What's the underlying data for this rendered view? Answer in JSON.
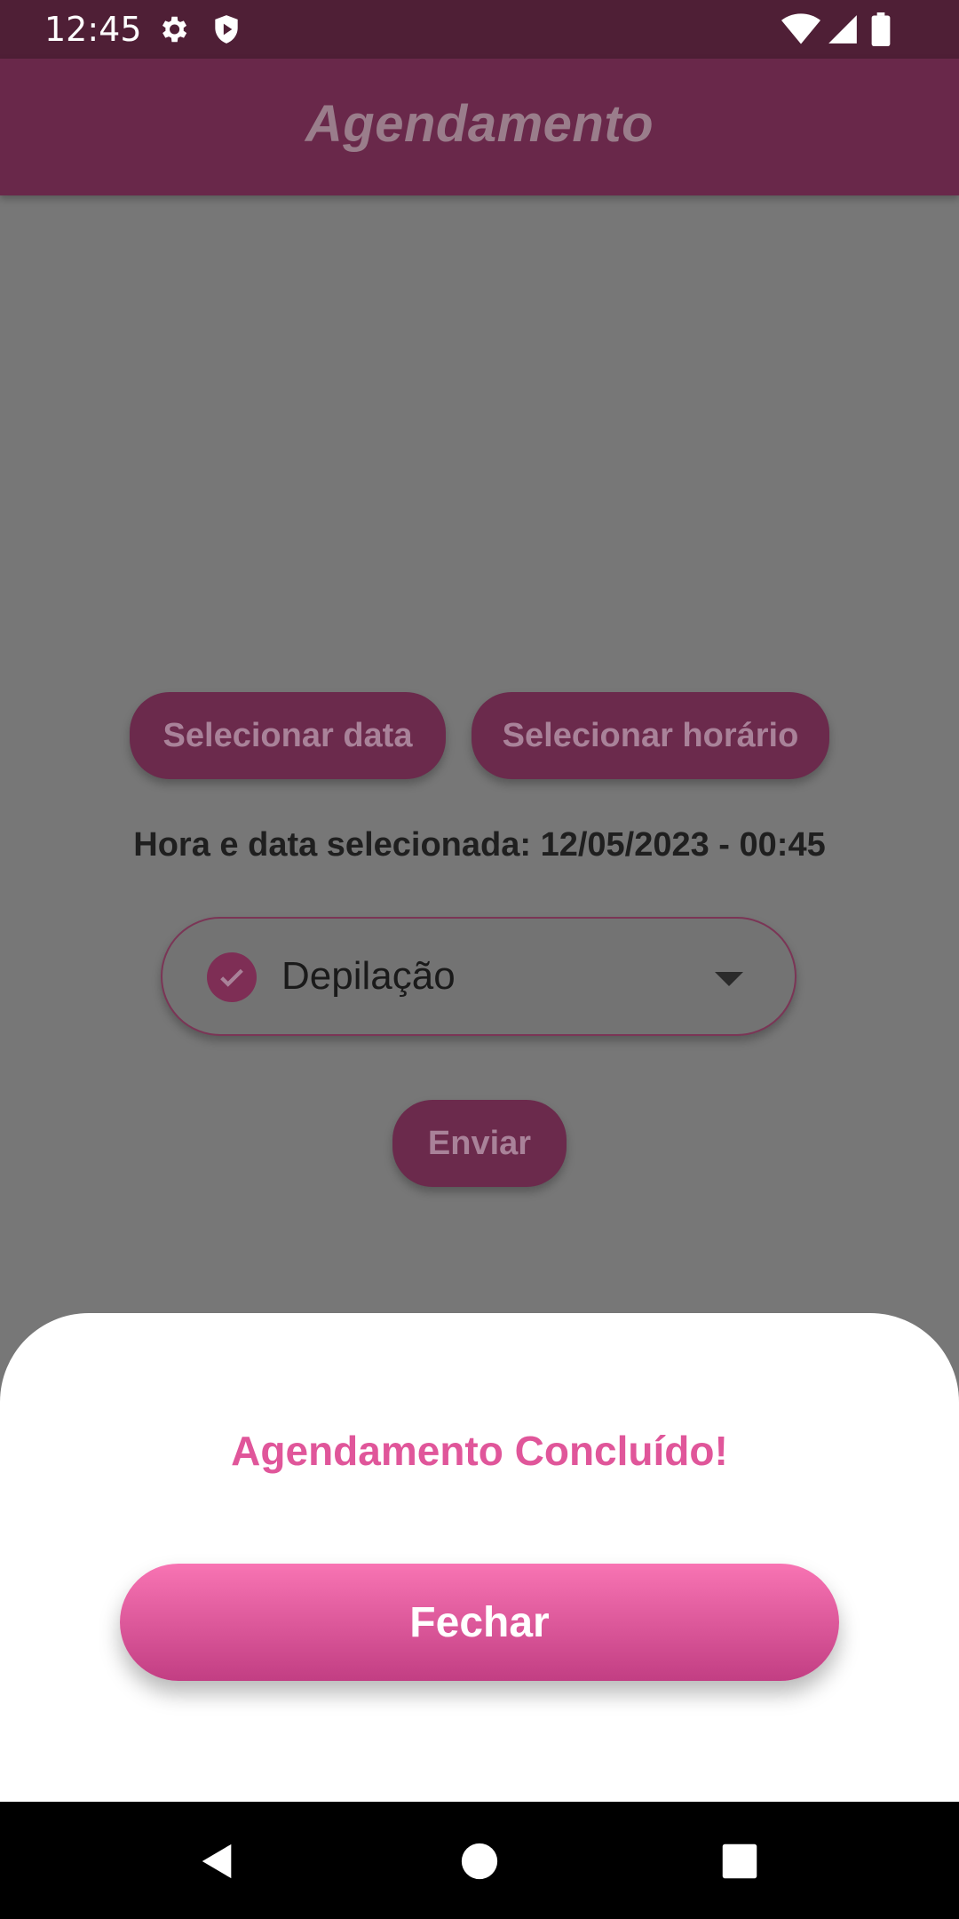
{
  "status_bar": {
    "time": "12:45",
    "icons_left": [
      "gear-icon",
      "shield-play-icon"
    ],
    "icons_right": [
      "wifi-icon",
      "signal-icon",
      "battery-icon"
    ]
  },
  "app_bar": {
    "title": "Agendamento"
  },
  "main": {
    "select_date_label": "Selecionar data",
    "select_time_label": "Selecionar horário",
    "selected_text": "Hora e data selecionada: 12/05/2023 - 00:45",
    "service_dropdown": {
      "value": "Depilação",
      "icon": "check-circle-icon"
    },
    "submit_label": "Enviar"
  },
  "sheet": {
    "title": "Agendamento Concluído!",
    "close_label": "Fechar"
  },
  "nav_bar": {
    "buttons": [
      "back-icon",
      "home-icon",
      "recents-icon"
    ]
  },
  "colors": {
    "primary": "#69284A",
    "accent_pink": "#E0569A",
    "button_gradient_top": "#F874B3",
    "button_gradient_bottom": "#C23E83"
  }
}
